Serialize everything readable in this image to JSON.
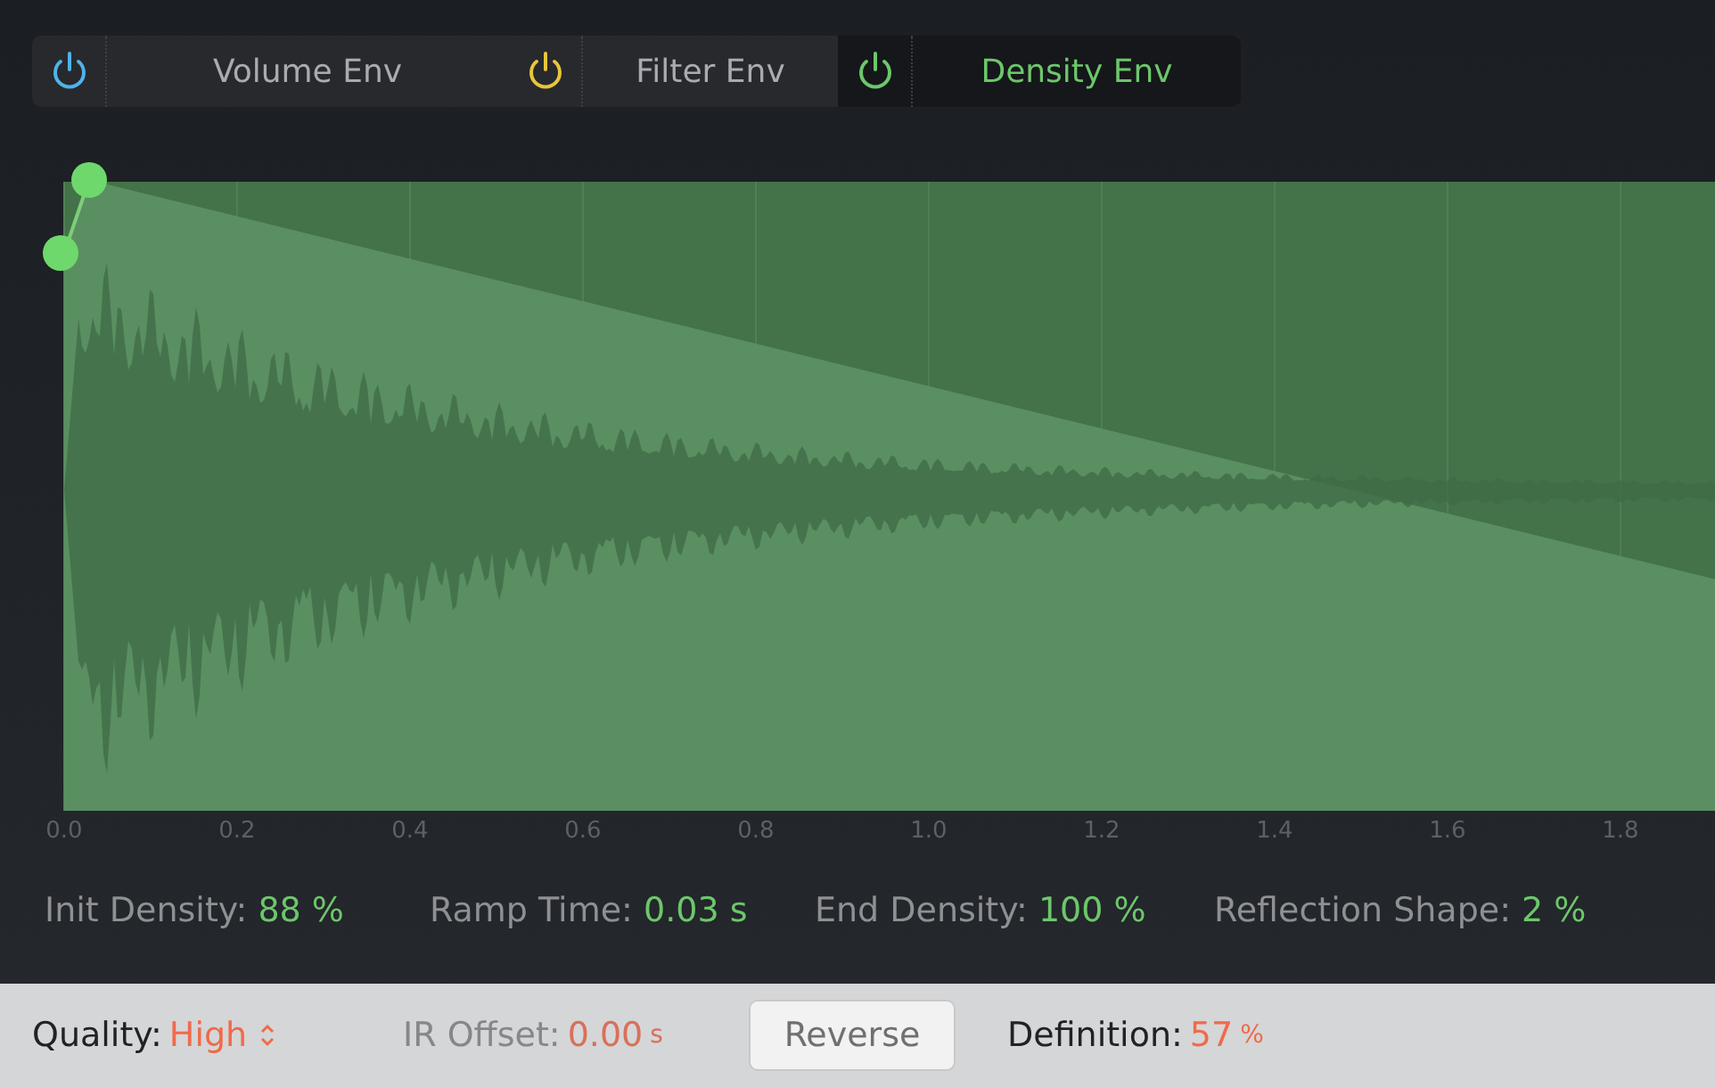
{
  "tabs": [
    {
      "label": "Volume Env",
      "color": "#4fb3e8",
      "selected": false
    },
    {
      "label": "Filter Env",
      "color": "#e8c53a",
      "selected": false
    },
    {
      "label": "Density Env",
      "color": "#6cc76a",
      "selected": true
    }
  ],
  "axis_labels": [
    "0.0",
    "0.2",
    "0.4",
    "0.6",
    "0.8",
    "1.0",
    "1.2",
    "1.4",
    "1.6",
    "1.8"
  ],
  "params": [
    {
      "label": "Init Density:",
      "value": "88 %"
    },
    {
      "label": "Ramp Time:",
      "value": "0.03 s"
    },
    {
      "label": "End Density:",
      "value": "100 %"
    },
    {
      "label": "Reflection Shape:",
      "value": "2 %"
    }
  ],
  "bottom": [
    {
      "kind": "popup",
      "label": "Quality:",
      "value": "High"
    },
    {
      "kind": "field",
      "label": "IR Offset:",
      "value": "0.00",
      "unit": "s",
      "disabled": true
    },
    {
      "kind": "button",
      "label": "Reverse"
    },
    {
      "kind": "field",
      "label": "Definition:",
      "value": "57",
      "unit": "%"
    }
  ]
}
